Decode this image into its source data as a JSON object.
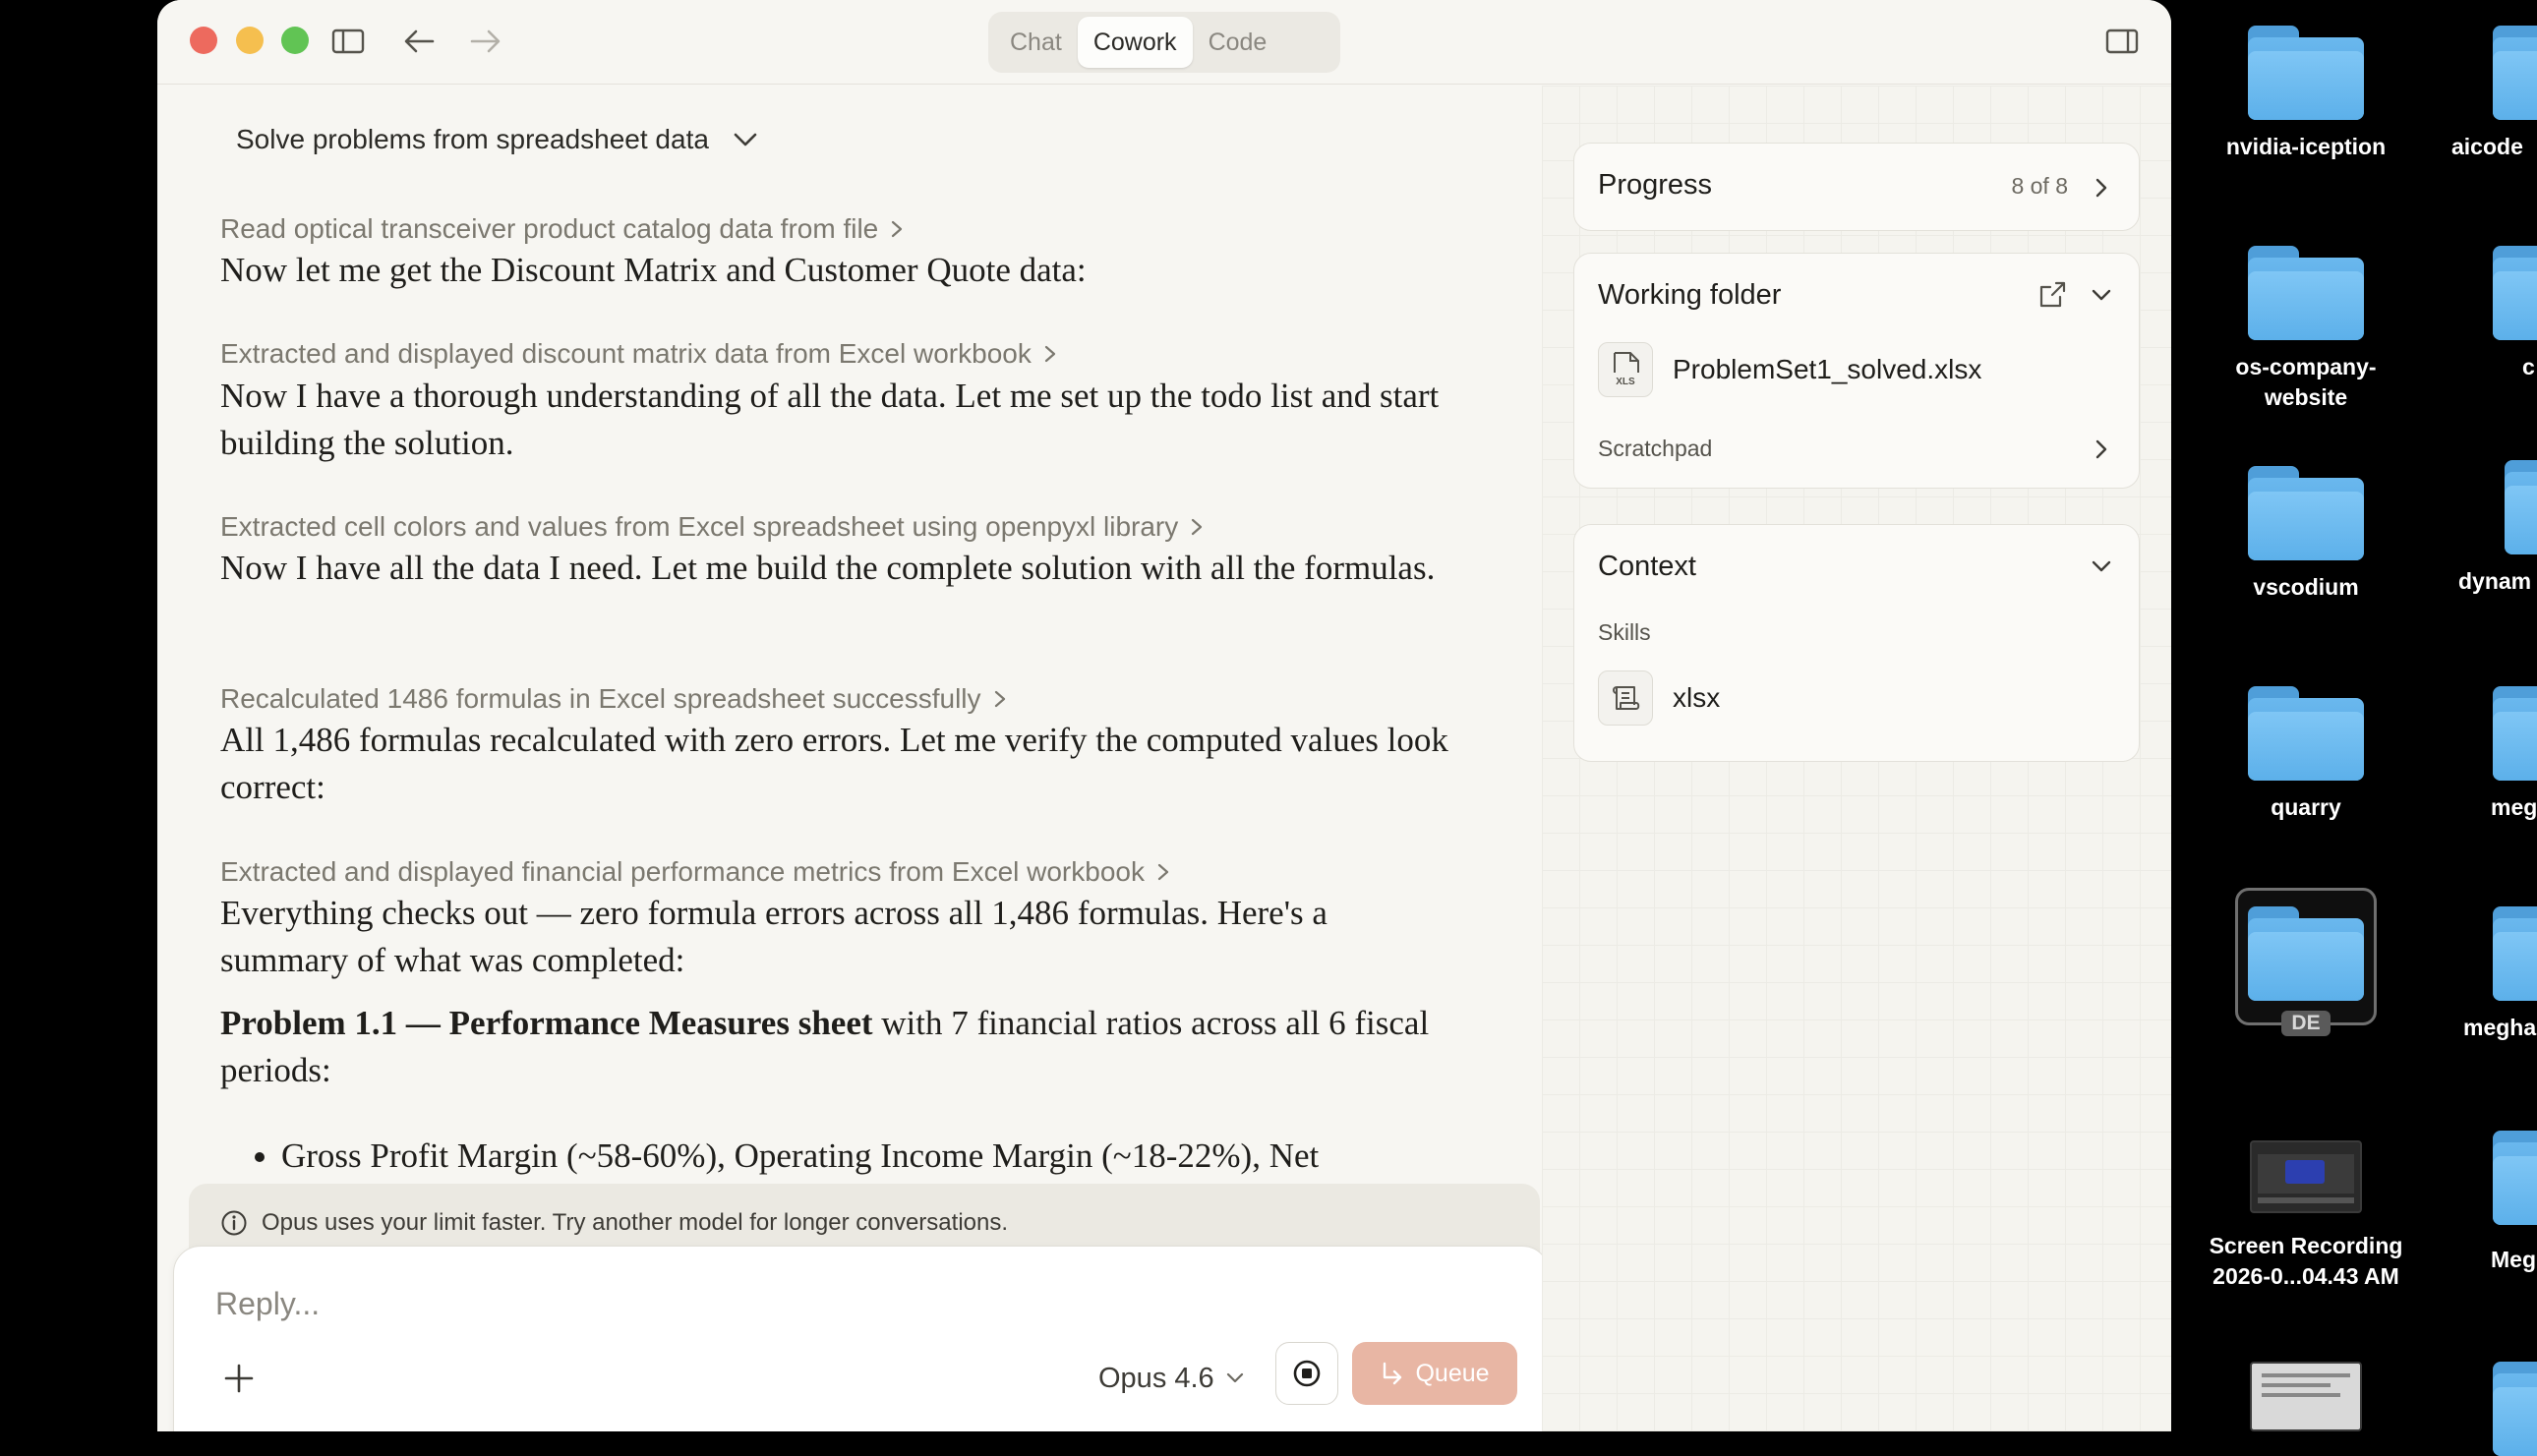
{
  "window": {
    "modes": [
      "Chat",
      "Cowork",
      "Code"
    ],
    "active_mode": "Cowork"
  },
  "conversation": {
    "title": "Solve problems from spreadsheet data",
    "items": [
      {
        "kind": "step",
        "text": "Read optical transceiver product catalog data from file"
      },
      {
        "kind": "msg",
        "text": "Now let me get the Discount Matrix and Customer Quote data:"
      },
      {
        "kind": "step",
        "text": "Extracted and displayed discount matrix data from Excel workbook"
      },
      {
        "kind": "msg",
        "text": "Now I have a thorough understanding of all the data. Let me set up the todo list and start building the solution."
      },
      {
        "kind": "step",
        "text": "Extracted cell colors and values from Excel spreadsheet using openpyxl library"
      },
      {
        "kind": "msg",
        "text": "Now I have all the data I need. Let me build the complete solution with all the formulas."
      },
      {
        "kind": "step",
        "text": "Recalculated 1486 formulas in Excel spreadsheet successfully"
      },
      {
        "kind": "msg",
        "text": "All 1,486 formulas recalculated with zero errors. Let me verify the computed values look correct:"
      },
      {
        "kind": "step",
        "text": "Extracted and displayed financial performance metrics from Excel workbook"
      },
      {
        "kind": "msg",
        "text": "Everything checks out — zero formula errors across all 1,486 formulas. Here's a summary of what was completed:"
      }
    ],
    "problem_bold": "Problem 1.1 — Performance Measures sheet",
    "problem_rest": " with 7 financial ratios across all 6 fiscal periods:",
    "bullet": "Gross Profit Margin (~58-60%), Operating Income Margin (~18-22%), Net"
  },
  "notice": "Opus uses your limit faster. Try another model for longer conversations.",
  "composer": {
    "placeholder": "Reply...",
    "model": "Opus 4.6",
    "queue_label": "Queue"
  },
  "panel": {
    "progress_title": "Progress",
    "progress_count": "8 of 8",
    "folder_title": "Working folder",
    "file_name": "ProblemSet1_solved.xlsx",
    "file_icon_text": "XLS",
    "scratchpad": "Scratchpad",
    "context_title": "Context",
    "skills_label": "Skills",
    "skill_name": "xlsx"
  },
  "desktop": [
    {
      "label": "nvidia-iception",
      "type": "folder"
    },
    {
      "label": "aicode",
      "type": "folder"
    },
    {
      "label": "os-company-\nwebsite",
      "type": "folder"
    },
    {
      "label": "c",
      "type": "folder"
    },
    {
      "label": "vscodium",
      "type": "folder"
    },
    {
      "label": "dynam",
      "type": "folder"
    },
    {
      "label": "quarry",
      "type": "folder"
    },
    {
      "label": "meg",
      "type": "folder"
    },
    {
      "label": "DE",
      "type": "folder-selected"
    },
    {
      "label": "megha",
      "type": "folder"
    },
    {
      "label": "Screen Recording\n2026-0...04.43 AM",
      "type": "video"
    },
    {
      "label": "Meg",
      "type": "folder"
    }
  ]
}
